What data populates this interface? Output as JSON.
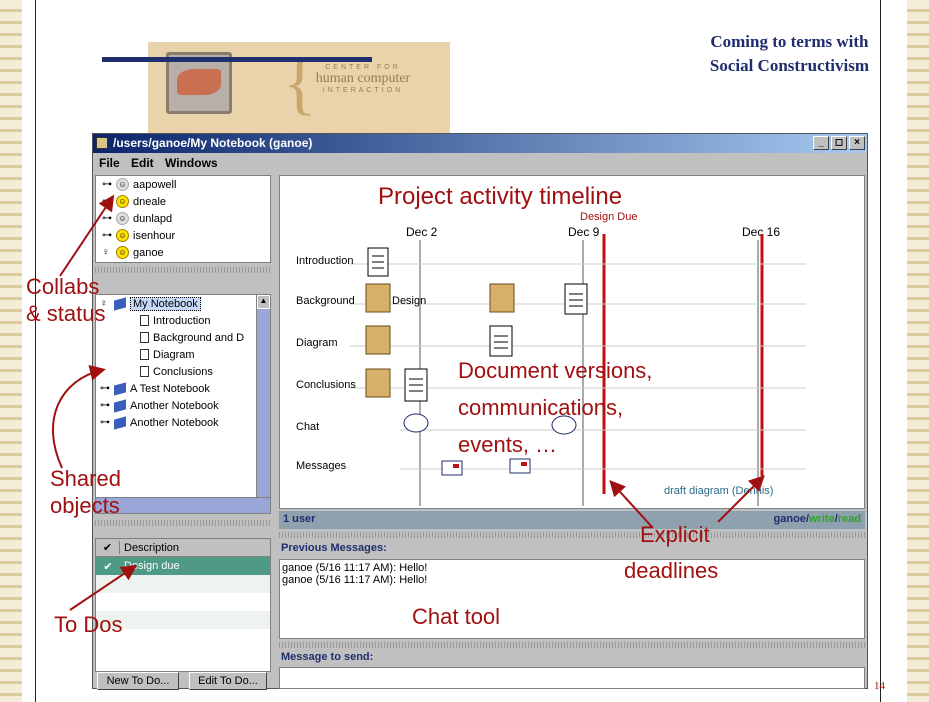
{
  "slide": {
    "title_line1": "Coming to terms with",
    "title_line2": "Social Constructivism",
    "page_number": "14",
    "logo": {
      "line1": "CENTER FOR",
      "line2": "human computer",
      "line3": "INTERACTION"
    }
  },
  "window": {
    "title": "/users/ganoe/My Notebook (ganoe)",
    "controls": [
      "_",
      "◻",
      "×"
    ],
    "menu": [
      "File",
      "Edit",
      "Windows"
    ]
  },
  "users": [
    {
      "name": "aapowell",
      "online": false
    },
    {
      "name": "dneale",
      "online": true
    },
    {
      "name": "dunlapd",
      "online": false
    },
    {
      "name": "isenhour",
      "online": true
    },
    {
      "name": "ganoe",
      "online": true
    }
  ],
  "tree": [
    {
      "label": "My Notebook",
      "type": "notebook",
      "depth": 0,
      "selected": true
    },
    {
      "label": "Introduction",
      "type": "page",
      "depth": 1
    },
    {
      "label": "Background and D",
      "type": "page",
      "depth": 1
    },
    {
      "label": "Diagram",
      "type": "page",
      "depth": 1
    },
    {
      "label": "Conclusions",
      "type": "page",
      "depth": 1
    },
    {
      "label": "A Test Notebook",
      "type": "notebook",
      "depth": 0
    },
    {
      "label": "Another Notebook",
      "type": "notebook",
      "depth": 0
    },
    {
      "label": "Another Notebook",
      "type": "notebook",
      "depth": 0
    }
  ],
  "todo": {
    "col_check": "✔",
    "col_desc": "Description",
    "items": [
      {
        "check": "✔",
        "desc": "Design due"
      }
    ],
    "new_button": "New To Do...",
    "edit_button": "Edit To Do..."
  },
  "timeline": {
    "title": "Project activity timeline",
    "dates": [
      "Dec 2",
      "Dec 9",
      "Dec 16"
    ],
    "deadline_label": "Design Due",
    "rows": [
      "Introduction",
      "Background",
      "Diagram",
      "Conclusions",
      "Chat",
      "Messages"
    ],
    "inline_label": "Design",
    "footer_label": "draft diagram (Dennis)"
  },
  "status": {
    "users": "1 user",
    "user": "ganoe",
    "perm_write": "write",
    "perm_read": "read"
  },
  "chat": {
    "prev_header": "Previous Messages:",
    "messages": [
      "ganoe (5/16 11:17 AM): Hello!",
      "ganoe (5/16 11:17 AM): Hello!"
    ],
    "send_header": "Message to send:"
  },
  "annotations": {
    "collabs_1": "Collabs",
    "collabs_2": "& status",
    "shared_1": "Shared",
    "shared_2": "objects",
    "todos": "To Dos",
    "docs_1": "Document versions,",
    "docs_2": "communications,",
    "docs_3": "events, …",
    "chat_tool": "Chat tool",
    "explicit_1": "Explicit",
    "explicit_2": "deadlines"
  },
  "colors": {
    "accent": "#a01010",
    "title": "#1f2e6e",
    "write": "#2fa02f",
    "read": "#2fa02f"
  }
}
